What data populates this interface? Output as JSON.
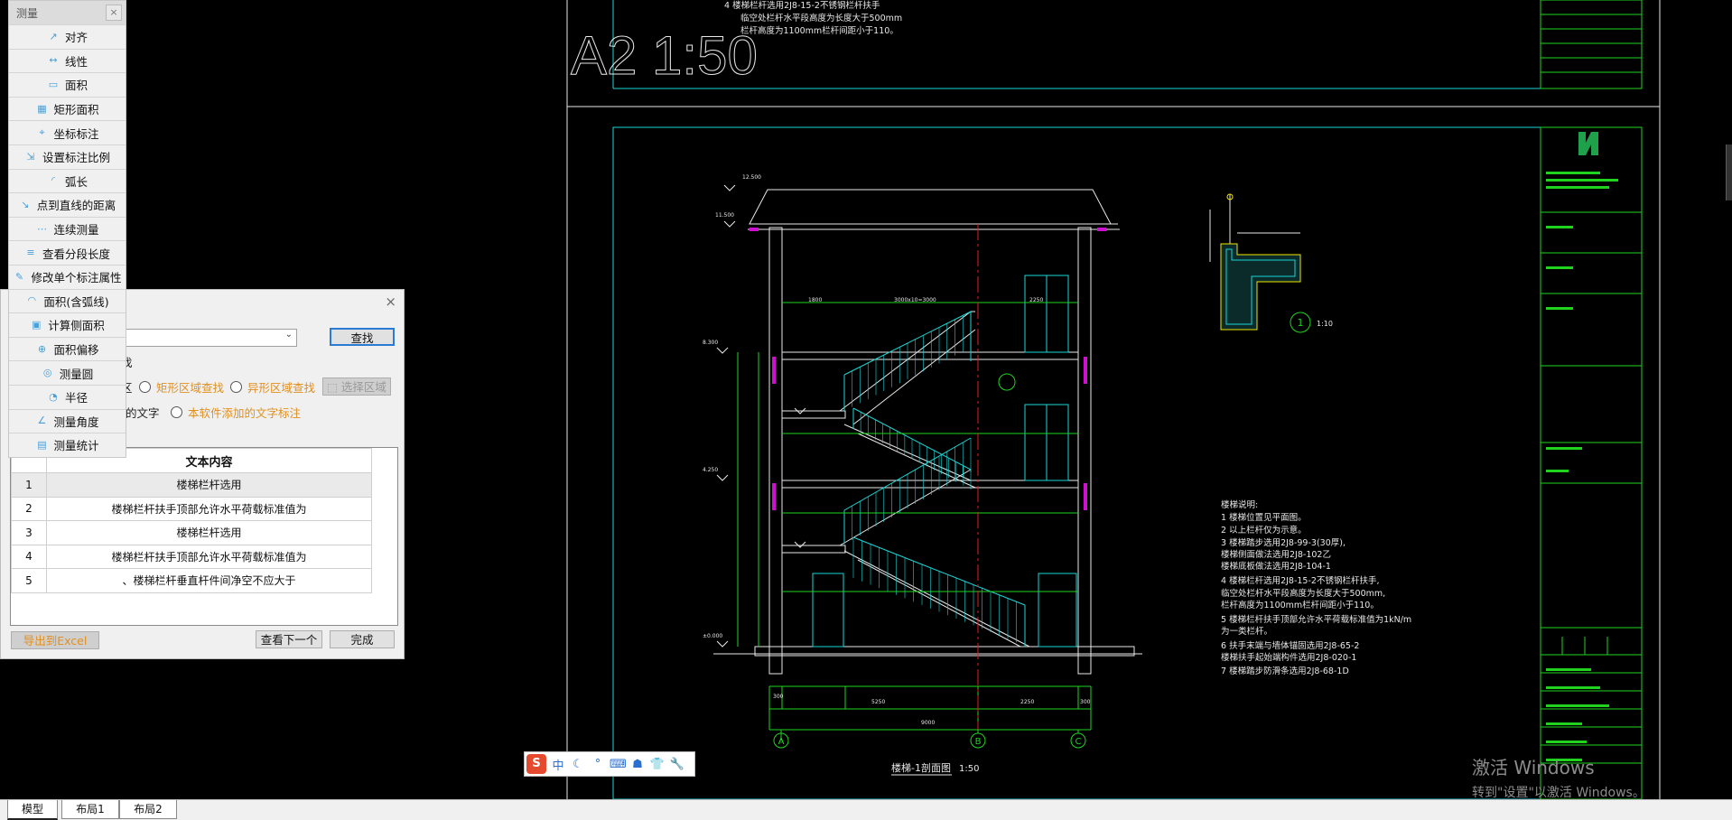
{
  "measure_panel": {
    "title": "测量",
    "close_label": "×",
    "items": [
      {
        "label": "对齐",
        "icon": "align-dim-icon"
      },
      {
        "label": "线性",
        "icon": "linear-dim-icon"
      },
      {
        "label": "面积",
        "icon": "area-icon"
      },
      {
        "label": "矩形面积",
        "icon": "rect-area-icon"
      },
      {
        "label": "坐标标注",
        "icon": "coordinate-icon"
      },
      {
        "label": "设置标注比例",
        "icon": "scale-icon"
      },
      {
        "label": "弧长",
        "icon": "arc-length-icon"
      },
      {
        "label": "点到直线的距离",
        "icon": "point-line-distance-icon"
      },
      {
        "label": "连续测量",
        "icon": "continuous-measure-icon"
      },
      {
        "label": "查看分段长度",
        "icon": "segment-length-icon"
      },
      {
        "label": "修改单个标注属性",
        "icon": "edit-dim-icon"
      },
      {
        "label": "面积(含弧线)",
        "icon": "arc-area-icon"
      },
      {
        "label": "计算侧面积",
        "icon": "side-area-icon"
      },
      {
        "label": "面积偏移",
        "icon": "area-offset-icon"
      },
      {
        "label": "测量圆",
        "icon": "circle-measure-icon"
      },
      {
        "label": "半径",
        "icon": "radius-icon"
      },
      {
        "label": "测量角度",
        "icon": "angle-icon"
      },
      {
        "label": "测量统计",
        "icon": "stats-icon"
      }
    ]
  },
  "find_dialog": {
    "close_label": "×",
    "find_button": "查找",
    "search_value": "",
    "option_fragment": "找",
    "radio_fragment": "区",
    "radio_rect": "矩形区域查找",
    "radio_irregular": "异形区域查找",
    "select_area_button": "选择区域",
    "radio_text_fragment": "的文字",
    "radio_added_text": "本软件添加的文字标注",
    "table_header": "文本内容",
    "rows": [
      {
        "idx": "1",
        "text": "楼梯栏杆选用"
      },
      {
        "idx": "2",
        "text": "楼梯栏杆扶手顶部允许水平荷载标准值为"
      },
      {
        "idx": "3",
        "text": "楼梯栏杆选用"
      },
      {
        "idx": "4",
        "text": "楼梯栏杆扶手顶部允许水平荷载标准值为"
      },
      {
        "idx": "5",
        "text": "、楼梯栏杆垂直杆件间净空不应大于"
      }
    ],
    "export_button": "导出到Excel",
    "next_button": "查看下一个",
    "done_button": "完成"
  },
  "drawing": {
    "sheet_label": "A2  1:50",
    "top_notes": [
      "4   楼梯栏杆选用2J8-15-2不锈钢栏杆扶手",
      "临空处栏杆水平段高度为长度大于500mm",
      "栏杆高度为1100mm栏杆间距小于110。"
    ],
    "section_title": "楼梯-1剖面图",
    "section_scale": "1:50",
    "detail_scale": "1:10",
    "detail_number": "1",
    "axis_labels": [
      "A",
      "B",
      "C"
    ],
    "notes_title": "楼梯说明:",
    "notes": [
      "1   楼梯位置见平面图。",
      "2   以上栏杆仅为示意。",
      "3   楼梯踏步选用2J8-99-3(30厚),",
      "     楼梯侧面做法选用2J8-102乙",
      "     楼梯底板做法选用2J8-104-1",
      "4   楼梯栏杆选用2J8-15-2不锈钢栏杆扶手,",
      "     临空处栏杆水平段高度为长度大于500mm,",
      "     栏杆高度为1100mm栏杆间距小于110。",
      "5   楼梯栏杆扶手顶部允许水平荷载标准值为1kN/m",
      "     为一类栏杆。",
      "6   扶手末端与墙体锚固选用2J8-65-2",
      "     楼梯扶手起始端构件选用2J8-020-1",
      "7   楼梯踏步防滑条选用2J8-68-1D"
    ],
    "dims": {
      "bottom_total": "9000",
      "bottom_parts": [
        "300",
        "5250",
        "2250",
        "300"
      ],
      "levels": [
        "12.500",
        "11.500",
        "8.300",
        "4.250",
        "±0.000"
      ],
      "spans": [
        "1800",
        "3000x10=3000",
        "2250"
      ]
    }
  },
  "ime": {
    "logo": "S",
    "items": [
      "中",
      "☾",
      "°",
      "⌨",
      "☗",
      "👕",
      "🔧"
    ]
  },
  "watermark": {
    "line1": "激活 Windows",
    "line2": "转到\"设置\"以激活 Windows。"
  },
  "tabs": [
    "模型",
    "布局1",
    "布局2"
  ],
  "colors": {
    "cad_green": "#1fd31f",
    "cad_cyan": "#19d7d7",
    "cad_red": "#e0202a",
    "cad_white": "#e8e8e8",
    "cad_yellow": "#f2e600",
    "cad_magenta": "#d010d0",
    "orange_text": "#e09020",
    "button_focus": "#2b7ad6"
  }
}
